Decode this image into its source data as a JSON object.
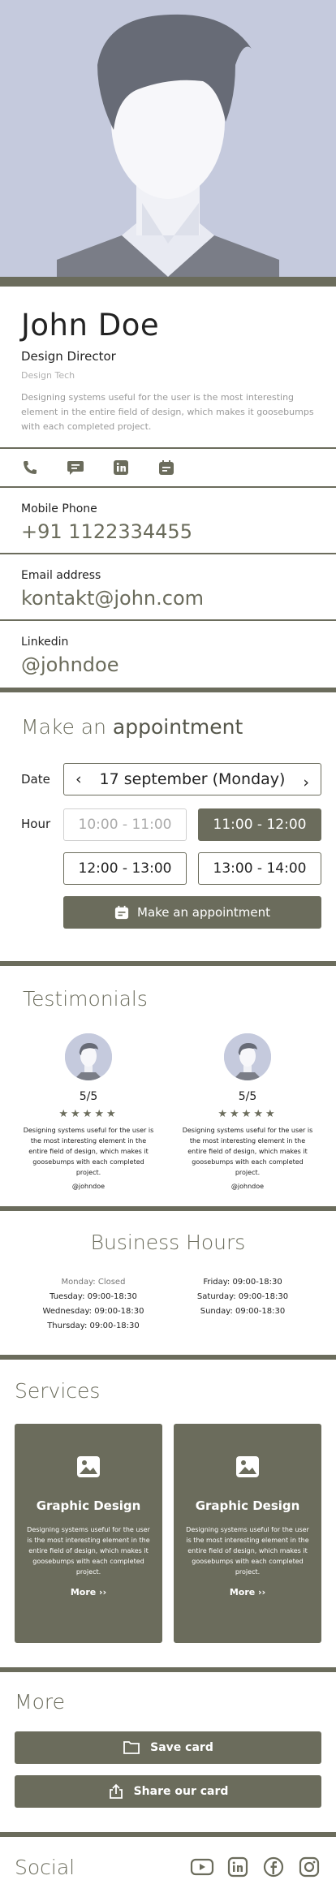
{
  "profile": {
    "name": "John Doe",
    "role": "Design Director",
    "company": "Design Tech",
    "bio": "Designing systems useful for the user is the most interesting element in the entire field of design, which makes it goosebumps with each completed project."
  },
  "contacts": [
    {
      "label": "Mobile Phone",
      "value": "+91 1122334455"
    },
    {
      "label": "Email address",
      "value": "kontakt@john.com"
    },
    {
      "label": "Linkedin",
      "value": "@johndoe"
    }
  ],
  "appointment": {
    "title_light": "Make an",
    "title_bold": "appointment",
    "date_label": "Date",
    "date_value": "17 september (Monday)",
    "prev": "‹",
    "next": "›",
    "hour_label": "Hour",
    "hours": [
      "10:00 - 11:00",
      "11:00 - 12:00",
      "12:00 - 13:00",
      "13:00 - 14:00"
    ],
    "button": "Make an appointment"
  },
  "testimonials": {
    "title": "Testimonials",
    "items": [
      {
        "score": "5/5",
        "stars": "★★★★★",
        "text": "Designing systems useful for the user is the most interesting element in the entire field of design, which makes it goosebumps with each completed project.",
        "handle": "@johndoe"
      },
      {
        "score": "5/5",
        "stars": "★★★★★",
        "text": "Designing systems useful for the user is the most interesting element in the entire field of design, which makes it goosebumps with each completed project.",
        "handle": "@johndoe"
      }
    ]
  },
  "business_hours": {
    "title": "Business Hours",
    "left": [
      "Monday: Closed",
      "Tuesday: 09:00-18:30",
      "Wednesday: 09:00-18:30",
      "Thursday: 09:00-18:30"
    ],
    "right": [
      "Friday: 09:00-18:30",
      "Saturday: 09:00-18:30",
      "Sunday: 09:00-18:30"
    ]
  },
  "services": {
    "title": "Services",
    "items": [
      {
        "title": "Graphic Design",
        "text": "Designing systems useful for the user is the most interesting element in the entire field of design, which makes it goosebumps with each completed project.",
        "more": "More ››"
      },
      {
        "title": "Graphic Design",
        "text": "Designing systems useful for the user is the most interesting element in the entire field of design, which makes it goosebumps with each completed project.",
        "more": "More ››"
      }
    ]
  },
  "more": {
    "title": "More",
    "save": "Save card",
    "share": "Share our card"
  },
  "social": {
    "title": "Social",
    "icons": [
      "youtube-icon",
      "linkedin-icon",
      "facebook-icon",
      "instagram-icon"
    ]
  },
  "colors": {
    "accent": "#6b6c5c",
    "hero_bg": "#c5cadd"
  }
}
